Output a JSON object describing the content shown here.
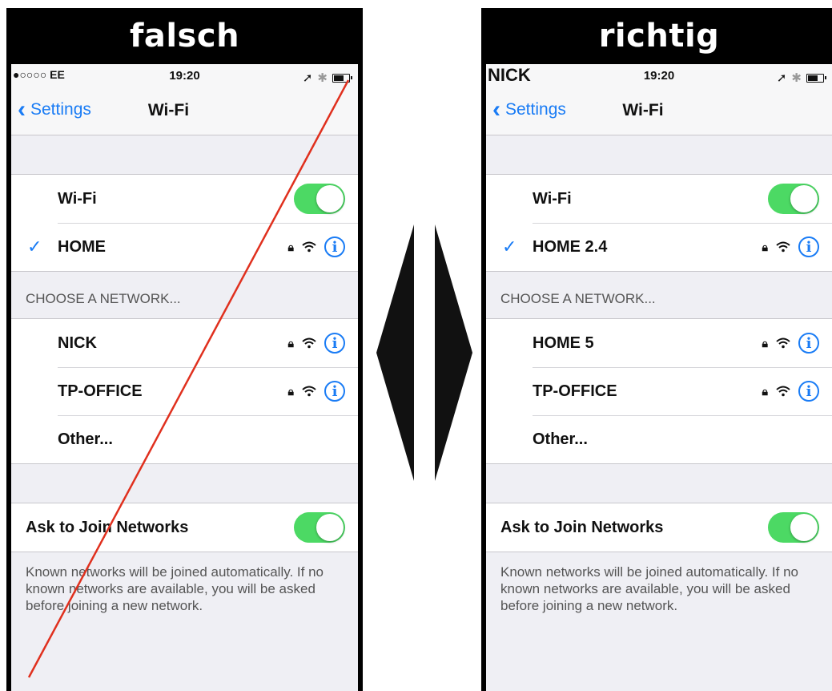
{
  "left": {
    "header": "falsch",
    "carrier": "●○○○○ EE",
    "time": "19:20",
    "back_label": "Settings",
    "title": "Wi-Fi",
    "wifi_label": "Wi-Fi",
    "connected": "HOME",
    "section_header": "CHOOSE A NETWORK...",
    "networks": [
      "NICK",
      "TP-OFFICE"
    ],
    "other": "Other...",
    "ask_join": "Ask to Join Networks",
    "footer": "Known networks will be joined automatically. If no known networks are available, you will be asked before joining a new network."
  },
  "right": {
    "header": "richtig",
    "carrier": "NICK",
    "time": "19:20",
    "back_label": "Settings",
    "title": "Wi-Fi",
    "wifi_label": "Wi-Fi",
    "connected": "HOME 2.4",
    "section_header": "CHOOSE A NETWORK...",
    "networks": [
      "HOME 5",
      "TP-OFFICE"
    ],
    "other": "Other...",
    "ask_join": "Ask to Join Networks",
    "footer": "Known networks will be joined automatically. If no known networks are available, you will be asked before joining a new network."
  },
  "icons": {
    "check": "checkmark-icon",
    "lock": "lock-icon",
    "wifi": "wifi-icon",
    "info": "info-icon",
    "back": "chevron-left-icon"
  },
  "colors": {
    "accent": "#1a7cf5",
    "toggle_on": "#4cd964",
    "strike": "#e0301e"
  }
}
